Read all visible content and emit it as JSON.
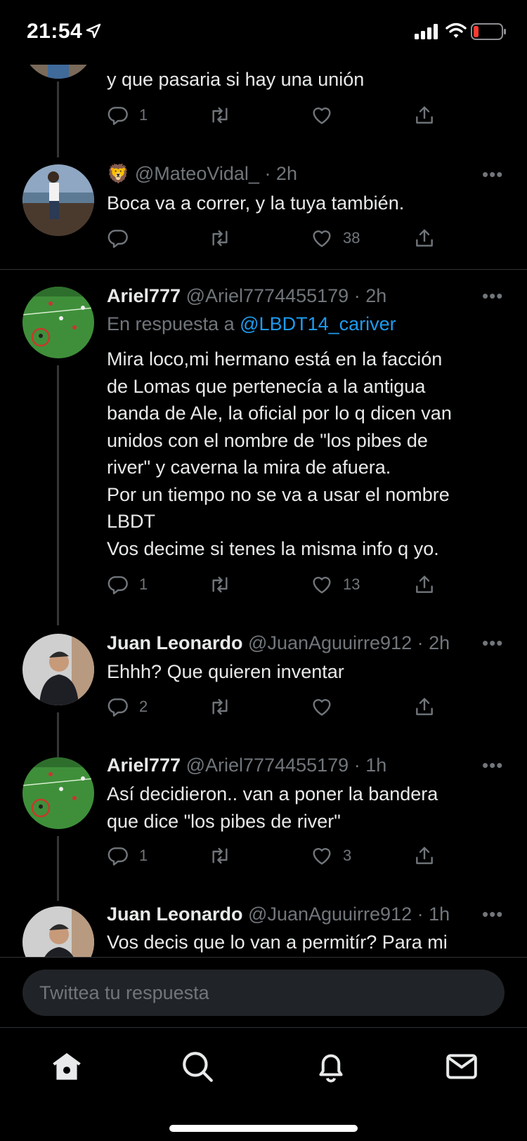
{
  "status": {
    "time": "21:54"
  },
  "tweets": [
    {
      "text": "y que pasaria si hay una unión",
      "counts": {
        "replies": "1",
        "retweets": "",
        "likes": ""
      }
    },
    {
      "emoji": "🦁",
      "name": "",
      "handle": "@MateoVidal_",
      "time": "· 2h",
      "text": "Boca va a correr, y la tuya también.",
      "counts": {
        "replies": "",
        "retweets": "",
        "likes": "38"
      }
    },
    {
      "name": "Ariel777",
      "handle": "@Ariel7774455179",
      "time": "· 2h",
      "reply_to_label": "En respuesta a",
      "reply_to_handle": "@LBDT14_cariver",
      "text": "Mira loco,mi hermano está en la facción\nde Lomas que pertenecía a la antigua\nbanda de Ale, la oficial por lo q dicen van\nunidos con el nombre de \"los pibes de\nriver\" y caverna la mira de afuera.\nPor un tiempo no se va a usar el nombre\nLBDT\nVos decime si tenes la misma info q yo.",
      "counts": {
        "replies": "1",
        "retweets": "",
        "likes": "13"
      }
    },
    {
      "name": "Juan Leonardo",
      "handle": "@JuanAguuirre912",
      "time": "· 2h",
      "text": "Ehhh? Que quieren inventar",
      "counts": {
        "replies": "2",
        "retweets": "",
        "likes": ""
      }
    },
    {
      "name": "Ariel777",
      "handle": "@Ariel7774455179",
      "time": "· 1h",
      "text": "Así decidieron.. van a poner la bandera\nque dice \"los pibes de river\"",
      "counts": {
        "replies": "1",
        "retweets": "",
        "likes": "3"
      }
    },
    {
      "name": "Juan Leonardo",
      "handle": "@JuanAguuirre912",
      "time": "· 1h",
      "text": "Vos decis que lo van a permitír? Para mi"
    }
  ],
  "more_label": "•••",
  "composer": {
    "placeholder": "Twittea tu respuesta"
  },
  "tabs": [
    "home-icon",
    "search-icon",
    "notifications-icon",
    "messages-icon"
  ],
  "colors": {
    "accent": "#1d9bf0",
    "muted": "#71767b",
    "text": "#e7e9ea",
    "background": "#000000"
  }
}
